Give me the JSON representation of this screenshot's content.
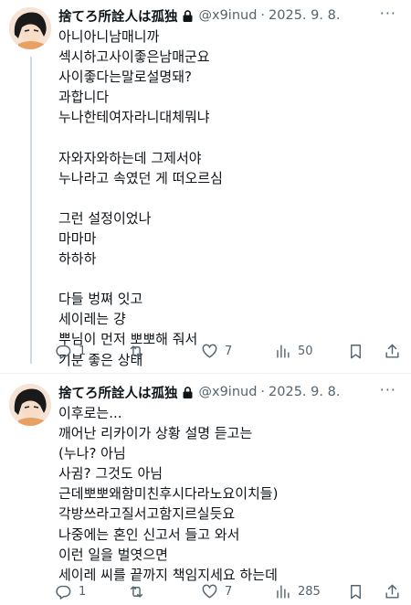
{
  "tweets": [
    {
      "name": "捨てろ所詮人は孤独",
      "handle": "@x9inud",
      "separator": "·",
      "date": "2025. 9. 8.",
      "lines": [
        "아니아니남매니까",
        "섹시하고사이좋은남매군요",
        "사이좋다는말로설명돼?",
        "과합니다",
        "누나한테여자라니대체뭐냐",
        "",
        "자와자와하는데 그제서야",
        "누나라고 속였던 게 떠오르심",
        "",
        "그런 설정이었나",
        "마마마",
        "하하하",
        "",
        "다들 벙쪄 잇고",
        "세이레는 걍",
        "뿌님이 먼저 뽀뽀해 줘서",
        "기분 좋은 상태"
      ],
      "replies": "1",
      "retweets": "",
      "likes": "7",
      "views": "50"
    },
    {
      "name": "捨てろ所詮人は孤独",
      "handle": "@x9inud",
      "separator": "·",
      "date": "2025. 9. 8.",
      "lines": [
        "이후로는...",
        "깨어난 리카이가 상황 설명 듣고는",
        "(누나? 아님",
        "사귐? 그것도 아님",
        "근데뽀뽀왜함미친후시다라노요이치들)",
        "각방쓰라고질서고함지르실듯요",
        "나중에는 혼인 신고서 들고 와서",
        "이런 일을 벌엿으면",
        "세이레 씨를 끝까지 책임지세요 하는데"
      ],
      "replies": "1",
      "retweets": "",
      "likes": "7",
      "views": "285"
    }
  ],
  "icons": {
    "lock": "lock-icon",
    "more": "more-icon",
    "reply": "reply-icon",
    "retweet": "retweet-icon",
    "like": "like-icon",
    "views": "views-icon",
    "bookmark": "bookmark-icon",
    "share": "share-icon"
  },
  "colors": {
    "text": "#0f1419",
    "secondary": "#536471",
    "thread_line": "#cfd9de"
  }
}
